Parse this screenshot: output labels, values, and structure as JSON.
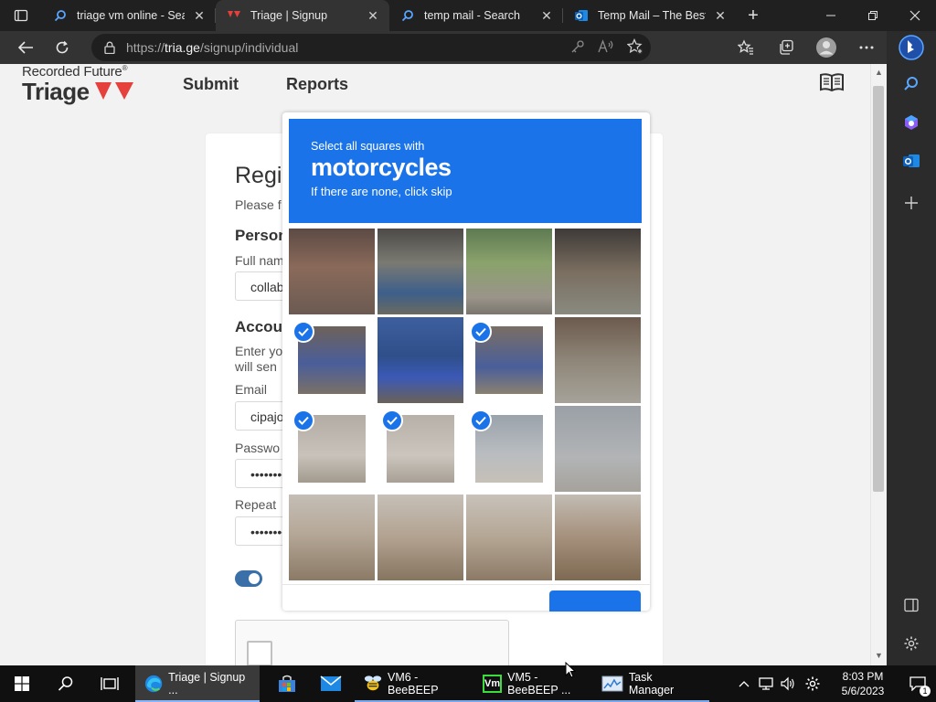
{
  "browser": {
    "tabs": [
      {
        "title": "triage vm online - Search",
        "icon": "search-icon",
        "active": false
      },
      {
        "title": "Triage | Signup",
        "icon": "triage-logo-icon",
        "active": true
      },
      {
        "title": "temp mail - Search",
        "icon": "search-icon",
        "active": false
      },
      {
        "title": "Temp Mail – The Best Temp Mail",
        "icon": "outlook-icon",
        "active": false
      }
    ],
    "url_scheme": "https://",
    "url_host": "tria.ge",
    "url_path": "/signup/individual"
  },
  "site": {
    "logo_top": "Recorded Future",
    "logo_reg": "®",
    "logo_main": "Triage",
    "nav": [
      "Submit",
      "Reports"
    ]
  },
  "form": {
    "title": "Register as Individual",
    "subtitle": "Please f",
    "section_personal": "Person",
    "full_name_label": "Full nam",
    "full_name_value": "collab",
    "section_account": "Accou",
    "account_desc_1": "Enter yo",
    "account_desc_2": "will sen",
    "email_label": "Email",
    "email_value": "cipajo",
    "password_label": "Passwo",
    "password_value": "••••••••",
    "repeat_label": "Repeat",
    "repeat_value": "••••••••"
  },
  "captcha": {
    "line1": "Select all squares with",
    "target": "motorcycles",
    "line3": "If there are none, click skip",
    "accent": "#1a73e8",
    "selected": [
      4,
      6,
      8,
      9,
      10
    ]
  },
  "taskbar": {
    "apps": [
      {
        "label": "Triage | Signup ...",
        "icon": "edge-icon",
        "active": true
      },
      {
        "label": "",
        "icon": "store-icon",
        "active": false
      },
      {
        "label": "",
        "icon": "mail-icon",
        "active": false
      },
      {
        "label": "VM6 - BeeBEEP",
        "icon": "beebeep-icon",
        "active": false
      },
      {
        "label": "VM5 - BeeBEEP ...",
        "icon": "vm-icon",
        "active": false
      },
      {
        "label": "Task Manager",
        "icon": "task-manager-icon",
        "active": false
      }
    ],
    "time": "8:03 PM",
    "date": "5/6/2023",
    "vm_badge": "Vm",
    "notif_count": "1"
  }
}
